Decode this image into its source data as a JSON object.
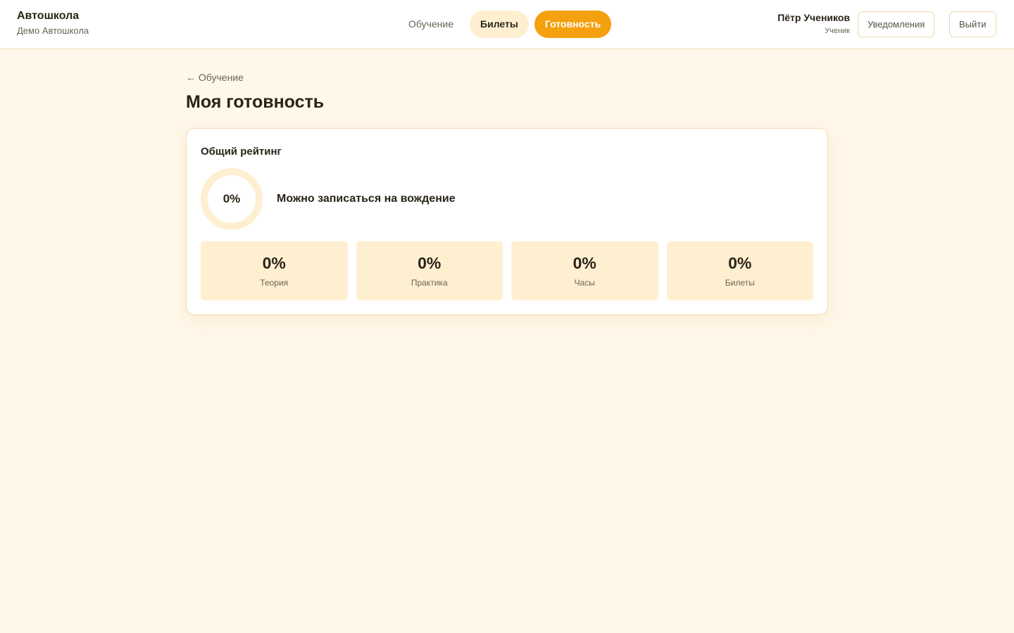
{
  "brand": {
    "title": "Автошкола",
    "subtitle": "Демо Автошкола"
  },
  "nav": {
    "items": [
      {
        "label": "Обучение",
        "state": "default"
      },
      {
        "label": "Билеты",
        "state": "hover"
      },
      {
        "label": "Готовность",
        "state": "active"
      }
    ]
  },
  "user": {
    "name": "Пётр Учеников",
    "role": "Ученик"
  },
  "header": {
    "notifications_label": "Уведомления",
    "logout_label": "Выйти"
  },
  "page": {
    "back_label": "← Обучение",
    "title": "Моя готовность"
  },
  "overall": {
    "title": "Общий рейтинг",
    "percent": 0,
    "value_label": "0%",
    "status": "Можно записаться на вождение"
  },
  "stats": [
    {
      "value": "0%",
      "label": "Теория"
    },
    {
      "value": "0%",
      "label": "Практика"
    },
    {
      "value": "0%",
      "label": "Часы"
    },
    {
      "value": "0%",
      "label": "Билеты"
    }
  ],
  "colors": {
    "accent": "#f4a00f",
    "accent_soft": "#ffefd1",
    "background": "#fff7e9",
    "text": "#2a2418",
    "muted": "#6b6356"
  }
}
